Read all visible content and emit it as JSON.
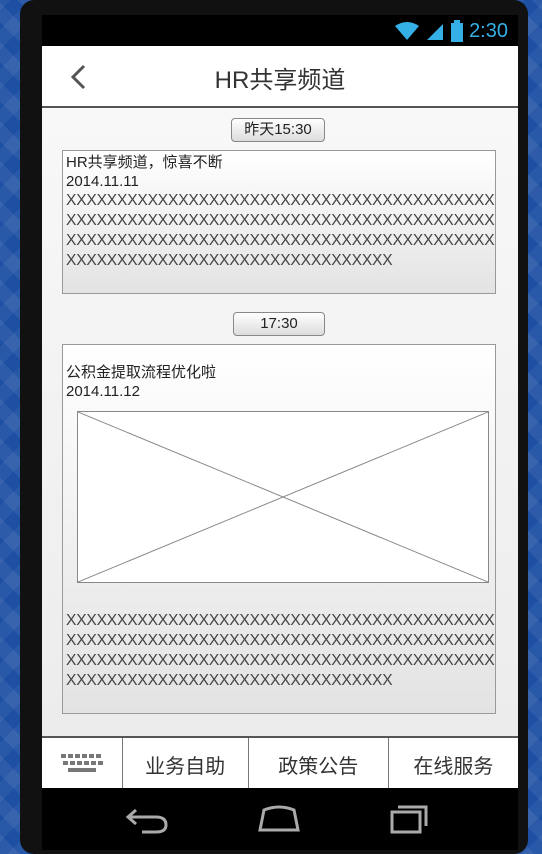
{
  "status_bar": {
    "time": "2:30",
    "icons": [
      "wifi-icon",
      "signal-icon",
      "battery-icon"
    ]
  },
  "header": {
    "title": "HR共享频道",
    "back_icon": "back-arrow-icon"
  },
  "messages": [
    {
      "time": "昨天15:30",
      "title": "HR共享频道，惊喜不断",
      "date": "2014.11.11",
      "body": "XXXXXXXXXXXXXXXXXXXXXXXXXXXXXXXXXXXXXXXXXXXXXXXXXXXXXXXXXXXXXXXXXXXXXXXXXXXXXXXXXXXXXXXXXXXXXXXXXXXXXXXXXXXXXXXXXXXXXXXXXXXXXXXXXXXXXXXXXXXXXXXXXXXXXXXXXXXXXX"
    },
    {
      "time": "17:30",
      "title": "公积金提取流程优化啦",
      "date": "2014.11.12",
      "body": "XXXXXXXXXXXXXXXXXXXXXXXXXXXXXXXXXXXXXXXXXXXXXXXXXXXXXXXXXXXXXXXXXXXXXXXXXXXXXXXXXXXXXXXXXXXXXXXXXXXXXXXXXXXXXXXXXXXXXXXXXXXXXXXXXXXXXXXXXXXXXXXXXXXXXXXXXXXXXX"
    }
  ],
  "tab_bar": {
    "keyboard_icon": "keyboard-icon",
    "tabs": [
      "业务自助",
      "政策公告",
      "在线服务"
    ]
  },
  "system_nav": [
    "back-icon",
    "home-icon",
    "recent-apps-icon"
  ],
  "colors": {
    "accent": "#35b0e6",
    "background": "#1d4fa3"
  }
}
